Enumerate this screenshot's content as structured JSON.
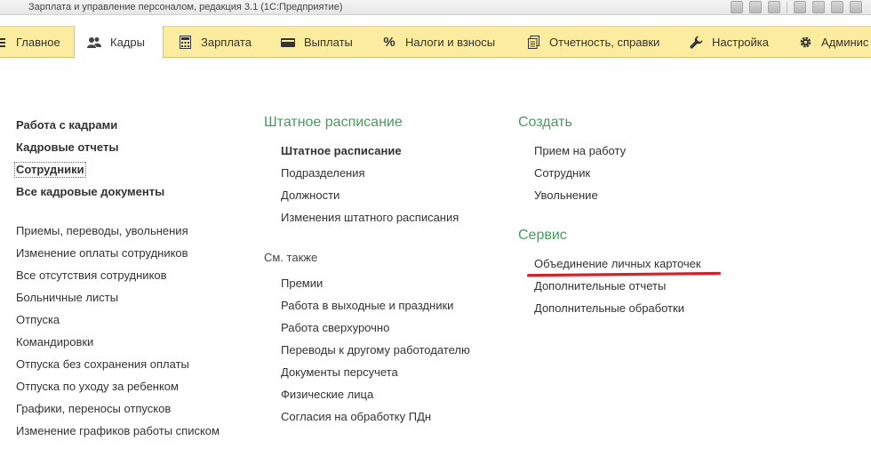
{
  "window": {
    "title": "Зарплата и управление персоналом, редакция 3.1  (1С:Предприятие)"
  },
  "sections": [
    {
      "label": "Главное",
      "icon": "menu-icon"
    },
    {
      "label": "Кадры",
      "icon": "people-icon",
      "active": true
    },
    {
      "label": "Зарплата",
      "icon": "calculator-icon"
    },
    {
      "label": "Выплаты",
      "icon": "wallet-icon"
    },
    {
      "label": "Налоги и взносы",
      "icon": "percent-icon"
    },
    {
      "label": "Отчетность, справки",
      "icon": "documents-icon"
    },
    {
      "label": "Настройка",
      "icon": "wrench-icon"
    },
    {
      "label": "Админис",
      "icon": "gear-icon"
    }
  ],
  "left_col": {
    "main_links": [
      "Работа с кадрами",
      "Кадровые отчеты",
      "Сотрудники",
      "Все кадровые документы"
    ],
    "doc_links": [
      "Приемы, переводы, увольнения",
      "Изменение оплаты сотрудников",
      "Все отсутствия сотрудников",
      "Больничные листы",
      "Отпуска",
      "Командировки",
      "Отпуска без сохранения оплаты",
      "Отпуска по уходу за ребенком",
      "Графики, переносы отпусков",
      "Изменение графиков работы списком"
    ]
  },
  "middle_col": {
    "title": "Штатное расписание",
    "links": [
      "Штатное расписание",
      "Подразделения",
      "Должности",
      "Изменения штатного расписания"
    ],
    "see_also_label": "См. также",
    "see_also_links": [
      "Премии",
      "Работа в выходные и праздники",
      "Работа сверхурочно",
      "Переводы к другому работодателю",
      "Документы персучета",
      "Физические лица",
      "Согласия на обработку ПДн"
    ]
  },
  "right_col": {
    "create_title": "Создать",
    "create_links": [
      "Прием на работу",
      "Сотрудник",
      "Увольнение"
    ],
    "service_title": "Сервис",
    "service_links": [
      "Объединение личных карточек",
      "Дополнительные отчеты",
      "Дополнительные обработки"
    ]
  },
  "colors": {
    "section_bg": "#fbeca0",
    "group_title": "#4a9a5e",
    "highlight": "#c8242a"
  }
}
